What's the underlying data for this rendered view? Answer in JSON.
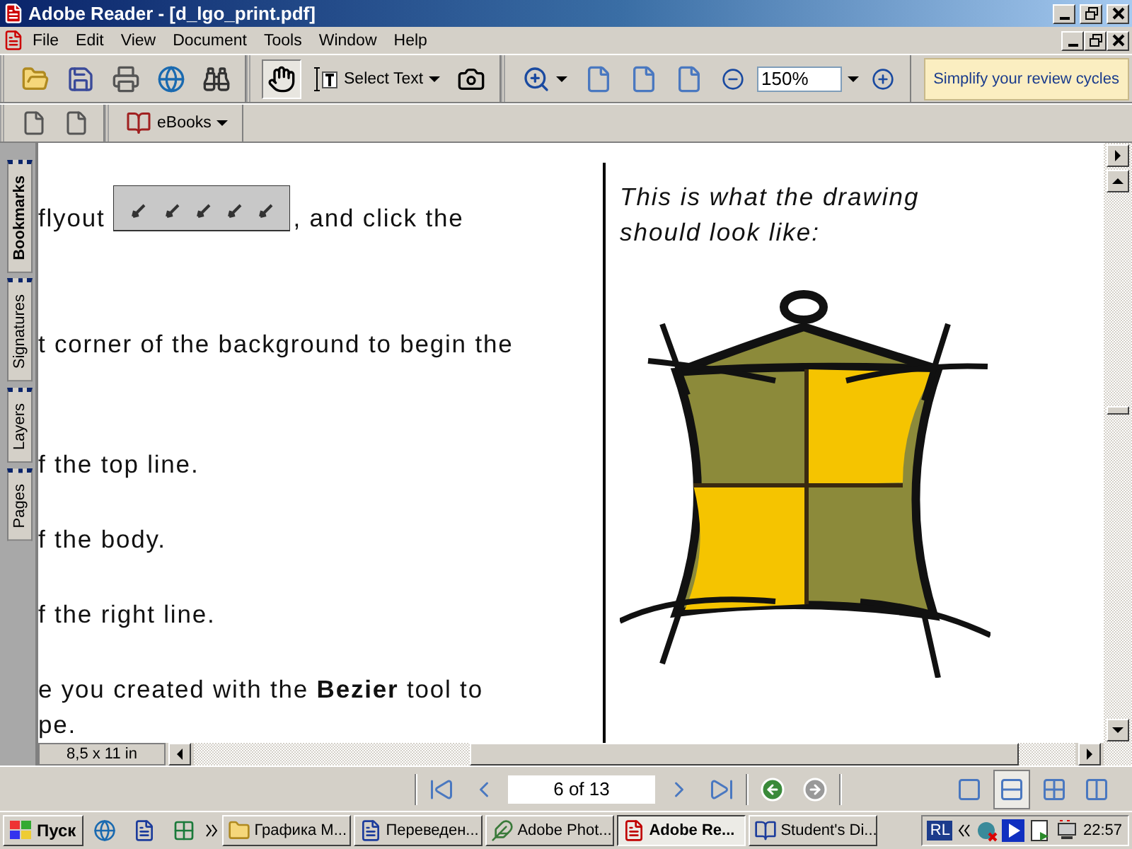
{
  "window": {
    "title": "Adobe Reader - [d_lgo_print.pdf]"
  },
  "menu": {
    "items": [
      "File",
      "Edit",
      "View",
      "Document",
      "Tools",
      "Window",
      "Help"
    ]
  },
  "toolbar": {
    "tools": [
      {
        "kind": "hand",
        "selected": true
      },
      {
        "kind": "select_text",
        "label": "Select Text",
        "selected": false
      },
      {
        "kind": "snapshot",
        "selected": false
      }
    ],
    "zoom": "150%",
    "banner": "Simplify your review cycles"
  },
  "toolbar2": {
    "ebooks": "eBooks"
  },
  "side_tabs": [
    {
      "label": "Bookmarks",
      "selected": true
    },
    {
      "label": "Signatures",
      "selected": false
    },
    {
      "label": "Layers",
      "selected": false
    },
    {
      "label": "Pages",
      "selected": false
    }
  ],
  "document": {
    "paragraphs": [
      {
        "kind": "with_image",
        "before": "flyout",
        "after": ", and click the"
      },
      {
        "kind": "text",
        "lines": [
          "t corner of the background to begin the"
        ]
      },
      {
        "kind": "text",
        "lines": [
          "f the top line."
        ]
      },
      {
        "kind": "text",
        "lines": [
          "f the body."
        ]
      },
      {
        "kind": "text",
        "lines": [
          "f the right line."
        ]
      },
      {
        "kind": "text",
        "lines": [
          "e you created with the **Bezier** tool to",
          "pe."
        ]
      }
    ],
    "caption": "This is what the drawing should look like:"
  },
  "status": {
    "page_size": "8,5 x 11 in"
  },
  "navigation": {
    "page": "6 of 13",
    "views": [
      {
        "kind": "single",
        "selected": false
      },
      {
        "kind": "continuous",
        "selected": true
      },
      {
        "kind": "facing",
        "selected": false
      },
      {
        "kind": "continuous_facing",
        "selected": false
      }
    ]
  },
  "taskbar": {
    "start": "Пуск",
    "tasks": [
      {
        "label": "Графика М...",
        "kind": "folder",
        "selected": false
      },
      {
        "label": "Переведен...",
        "kind": "word",
        "selected": false
      },
      {
        "label": "Adobe Phot...",
        "kind": "photoshop",
        "selected": false
      },
      {
        "label": "Adobe Re...",
        "kind": "reader",
        "selected": true
      },
      {
        "label": "Student's Di...",
        "kind": "book",
        "selected": false
      }
    ],
    "language": "RL",
    "clock": "22:57"
  }
}
